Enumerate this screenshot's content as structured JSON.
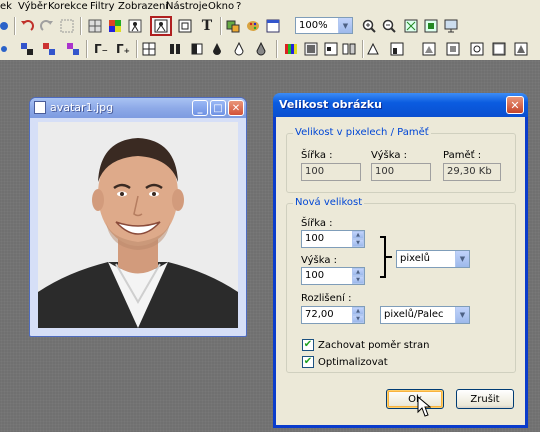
{
  "menubar": {
    "items": [
      "ek",
      "Výběr",
      "Korekce",
      "Filtry",
      "Zobrazení",
      "Nástroje",
      "Okno",
      "?"
    ]
  },
  "toolbar": {
    "zoom_value": "100%",
    "icons_row1": [
      "open-icon",
      "undo-icon",
      "redo-icon",
      "select-icon",
      "grid-icon",
      "colors-icon",
      "person-icon",
      "resize-image-icon",
      "canvas-icon",
      "text-icon",
      "tools-icon",
      "palette-icon",
      "window-icon",
      "zoom-in-icon",
      "zoom-out-icon",
      "fit-icon",
      "actual-size-icon",
      "fullscreen-icon"
    ],
    "icons_row2": [
      "effect-icon",
      "gamma-down-icon",
      "gamma-up-icon",
      "grid-icon",
      "bars-icon",
      "contrast-icon",
      "drop-icon",
      "drop-outline-icon",
      "color-bars-icon",
      "levels-icon",
      "mirror-icon",
      "rotate-icon",
      "flip-icon"
    ]
  },
  "image_window": {
    "title": "avatar1.jpg"
  },
  "dialog": {
    "title": "Velikost obrázku",
    "current_group": {
      "label": "Velikost v pixelech / Paměť",
      "width_label": "Šířka :",
      "height_label": "Výška :",
      "memory_label": "Paměť :",
      "width_value": "100",
      "height_value": "100",
      "memory_value": "29,30 Kb"
    },
    "new_group": {
      "label": "Nová velikost",
      "width_label": "Šířka :",
      "width_value": "100",
      "height_label": "Výška :",
      "height_value": "100",
      "unit_value": "pixelů",
      "resolution_label": "Rozlišení :",
      "resolution_value": "72,00",
      "resolution_unit": "pixelů/Palec",
      "keep_ratio_label": "Zachovat poměr stran",
      "keep_ratio_checked": true,
      "optimize_label": "Optimalizovat",
      "optimize_checked": true
    },
    "ok_label": "Ok",
    "cancel_label": "Zrušit"
  },
  "colors": {
    "workspace": "#707070",
    "dialog_title": "#0a5ce0",
    "group_label": "#0046d5",
    "active_border": "#b02020"
  }
}
